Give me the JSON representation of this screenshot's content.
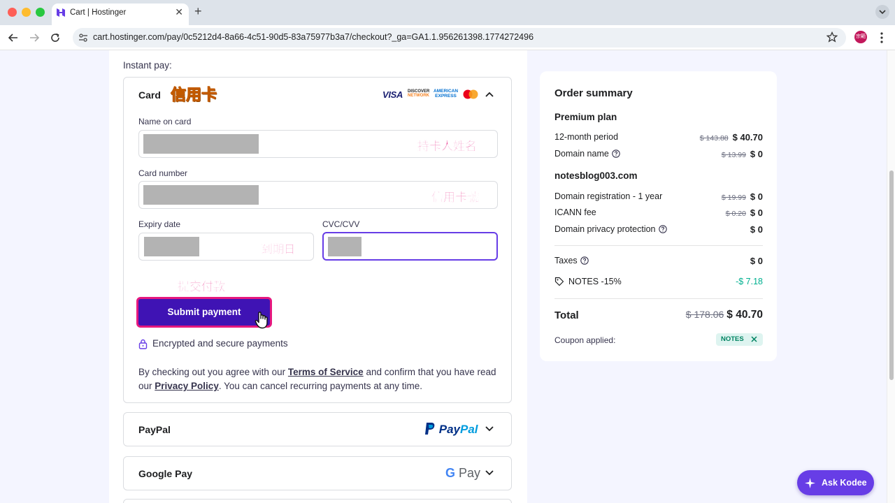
{
  "browser": {
    "tab_title": "Cart | Hostinger",
    "url": "cart.hostinger.com/pay/0c5212d4-8a66-4c51-90d5-83a75977b3a7/checkout?_ga=GA1.1.956261398.1774272496",
    "profile_initials": "宗範"
  },
  "payment": {
    "section_label": "Instant pay:",
    "card": {
      "title": "Card",
      "annotation": "信用卡",
      "brands": {
        "visa": "VISA",
        "discover": "DISCOVER",
        "discover_sub": "NETWORK",
        "amex_line1": "AMERICAN",
        "amex_line2": "EXPRESS"
      },
      "name_label": "Name on card",
      "name_annotation": "持卡人姓名",
      "number_label": "Card number",
      "number_annotation": "信用卡號",
      "expiry_label": "Expiry date",
      "expiry_annotation": "到期日",
      "cvc_label": "CVC/CVV",
      "submit_annotation": "提交付款",
      "submit_label": "Submit payment",
      "secure_text": "Encrypted and secure payments",
      "terms": {
        "part1": "By checking out you agree with our ",
        "tos_link": "Terms of Service",
        "part2": " and confirm that you have read our ",
        "privacy_link": "Privacy Policy",
        "part3": ". You can cancel recurring payments at any time."
      }
    },
    "paypal": {
      "title": "PayPal",
      "logo_pay": "Pay",
      "logo_pal": "Pal"
    },
    "googlepay": {
      "title": "Google Pay",
      "logo_g": "G",
      "logo_pay": "Pay"
    }
  },
  "summary": {
    "title": "Order summary",
    "plan": "Premium plan",
    "rows_plan": [
      {
        "label": "12-month period",
        "old": "$ 143.88",
        "price": "$ 40.70"
      },
      {
        "label": "Domain name",
        "old": "$ 13.99",
        "price": "$ 0"
      }
    ],
    "domain": "notesblog003.com",
    "rows_domain": [
      {
        "label": "Domain registration - 1 year",
        "old": "$ 19.99",
        "price": "$ 0"
      },
      {
        "label": "ICANN fee",
        "old": "$ 0.20",
        "price": "$ 0"
      },
      {
        "label": "Domain privacy protection",
        "price": "$ 0"
      }
    ],
    "taxes_label": "Taxes",
    "taxes_value": "$ 0",
    "discount_label": "NOTES -15%",
    "discount_value": "-$ 7.18",
    "total_label": "Total",
    "total_old": "$ 178.06",
    "total_price": "$ 40.70",
    "coupon_label": "Coupon applied:",
    "coupon_code": "NOTES"
  },
  "kodee": {
    "label": "Ask Kodee"
  },
  "colors": {
    "brand_purple": "#673de6",
    "submit_bg": "#3f13b4",
    "annotation_pink": "#e6187e",
    "annotation_orange": "#ffb400",
    "discount_green": "#00b090"
  }
}
